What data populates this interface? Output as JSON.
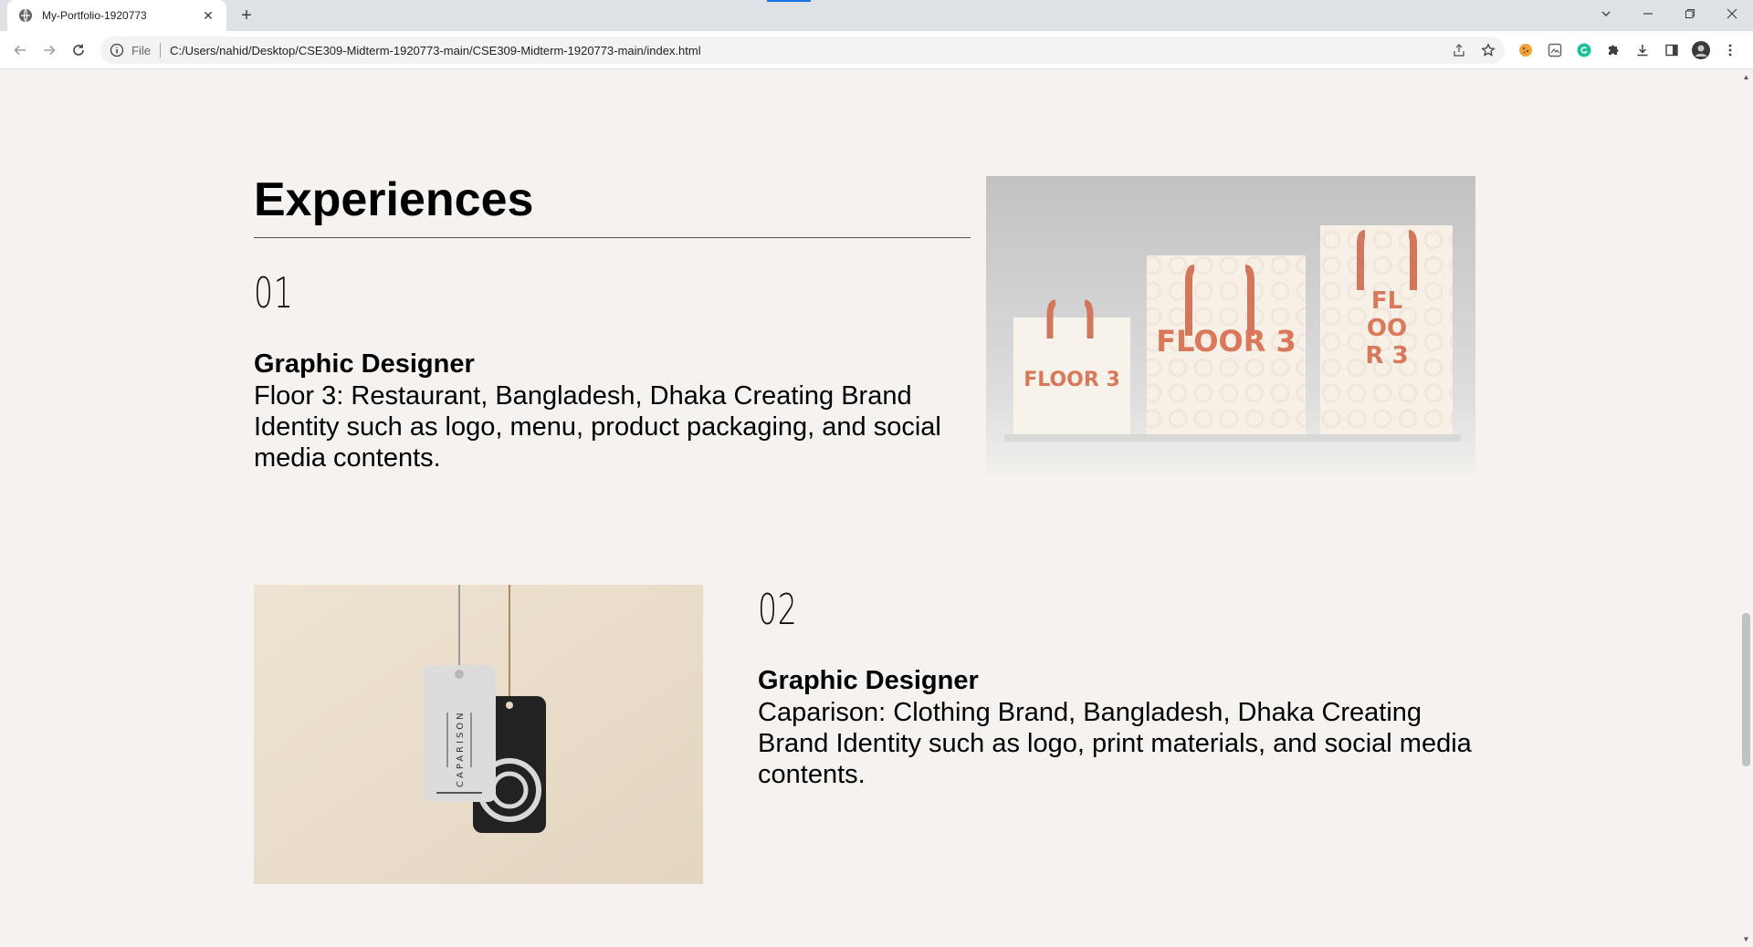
{
  "browser": {
    "tab_title": "My-Portfolio-1920773",
    "scheme_label": "File",
    "url": "C:/Users/nahid/Desktop/CSE309-Midterm-1920773-main/CSE309-Midterm-1920773-main/index.html",
    "colors": {
      "tabbar": "#dee1e6",
      "toolbar": "#ffffff",
      "omnibox": "#f1f3f4",
      "accent": "#1a73e8"
    },
    "icons": [
      "globe-icon",
      "close-icon",
      "plus-icon",
      "back-icon",
      "forward-icon",
      "reload-icon",
      "info-icon",
      "share-icon",
      "star-icon",
      "cookie-icon",
      "extension-icon",
      "grammarly-icon",
      "puzzle-icon",
      "download-icon",
      "sidepanel-icon",
      "profile-avatar",
      "menu-kebab-icon"
    ]
  },
  "page": {
    "background": "#f5f2ef",
    "section_title": "Experiences",
    "experiences": [
      {
        "number": "01",
        "title": "Graphic Designer",
        "description": "Floor 3: Restaurant, Bangladesh, Dhaka Creating Brand Identity such as logo, menu, product packaging, and social media contents.",
        "image": {
          "subject": "shopping bags",
          "brand_text_small": "FLOOR 3",
          "brand_text_mid": "FLOOR 3",
          "brand_text_tall_1": "FL",
          "brand_text_tall_2": "OO",
          "brand_text_tall_3": "R 3",
          "brand_color": "#d9785a"
        }
      },
      {
        "number": "02",
        "title": "Graphic Designer",
        "description": "Caparison: Clothing Brand, Bangladesh, Dhaka Creating Brand Identity such as logo, print materials, and social media contents.",
        "image": {
          "subject": "hang tags",
          "brand_text": "CAPARISON",
          "background_color": "#e9dcc8"
        }
      }
    ]
  }
}
